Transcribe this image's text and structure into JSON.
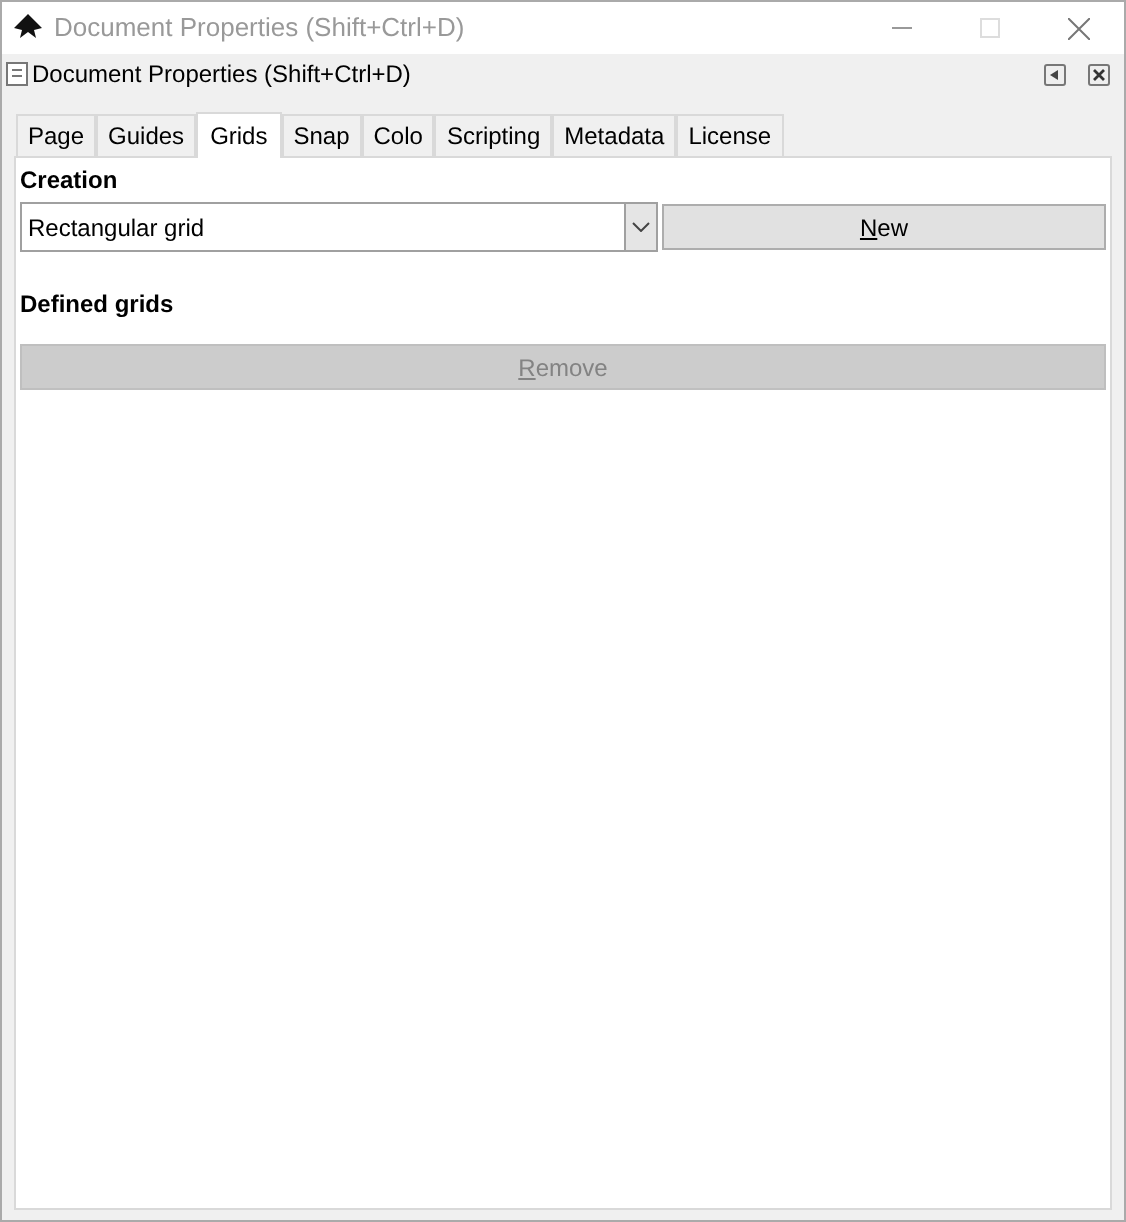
{
  "window": {
    "title": "Document Properties (Shift+Ctrl+D)",
    "active": false
  },
  "dialog": {
    "title": "Document Properties (Shift+Ctrl+D)"
  },
  "tabs": [
    {
      "label": "Page",
      "selected": false
    },
    {
      "label": "Guides",
      "selected": false
    },
    {
      "label": "Grids",
      "selected": true
    },
    {
      "label": "Snap",
      "selected": false
    },
    {
      "label": "Colo",
      "selected": false
    },
    {
      "label": "Scripting",
      "selected": false
    },
    {
      "label": "Metadata",
      "selected": false
    },
    {
      "label": "License",
      "selected": false
    }
  ],
  "creation": {
    "heading": "Creation",
    "grid_type": "Rectangular grid",
    "new_button": {
      "label": "New",
      "mnemonic_first": true,
      "disabled": false
    }
  },
  "defined_grids": {
    "heading": "Defined grids",
    "remove_button": {
      "label": "Remove",
      "mnemonic_first": true,
      "disabled": true
    }
  }
}
